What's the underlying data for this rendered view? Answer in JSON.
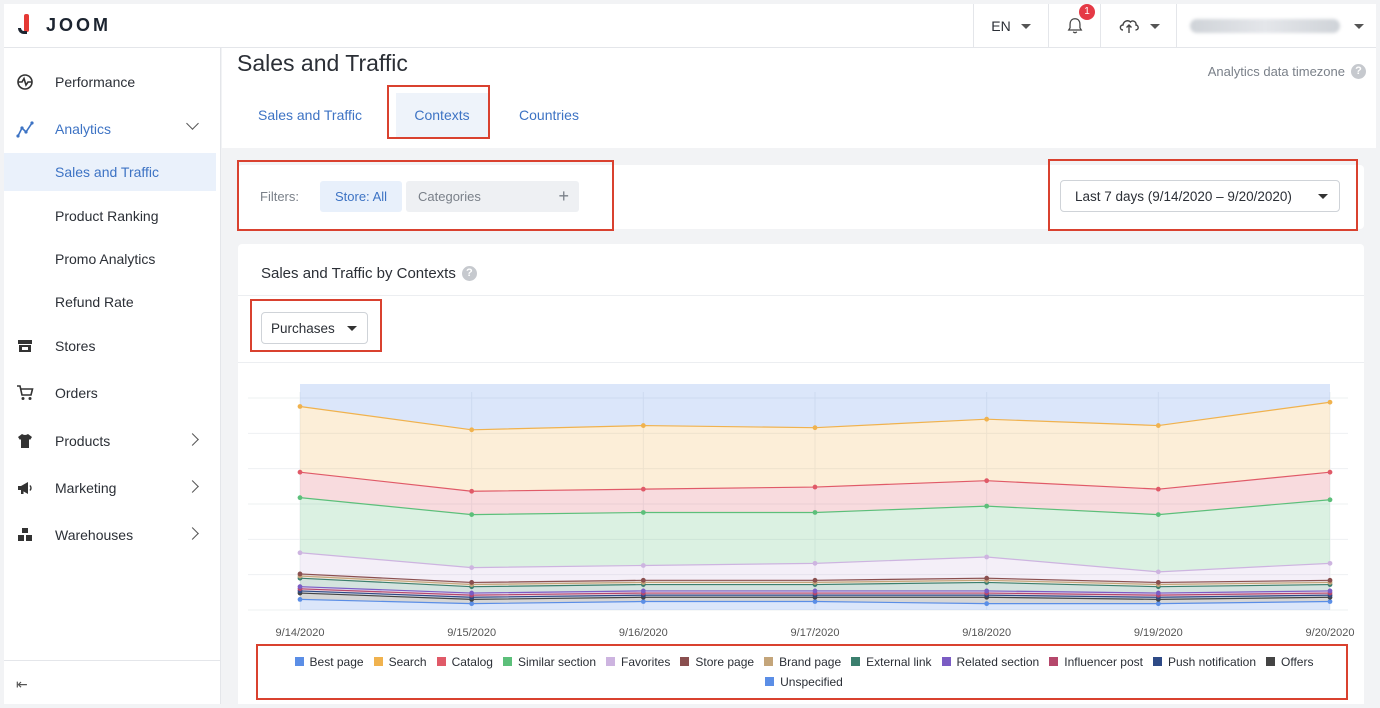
{
  "brand": {
    "name": "JOOM"
  },
  "topbar": {
    "language": "EN",
    "notifications_count": "1"
  },
  "sidebar": {
    "items": [
      {
        "label": "Performance",
        "icon": "performance-icon"
      },
      {
        "label": "Analytics",
        "icon": "analytics-icon"
      },
      {
        "label": "Stores",
        "icon": "store-icon"
      },
      {
        "label": "Orders",
        "icon": "cart-icon"
      },
      {
        "label": "Products",
        "icon": "shirt-icon"
      },
      {
        "label": "Marketing",
        "icon": "megaphone-icon"
      },
      {
        "label": "Warehouses",
        "icon": "warehouse-icon"
      }
    ],
    "analytics_sub": [
      "Sales and Traffic",
      "Product Ranking",
      "Promo Analytics",
      "Refund Rate"
    ],
    "collapse_glyph": "⇤"
  },
  "header": {
    "title": "Sales and Traffic",
    "timezone_label": "Analytics data timezone",
    "tabs": [
      "Sales and Traffic",
      "Contexts",
      "Countries"
    ],
    "active_tab": "Contexts"
  },
  "filters": {
    "label": "Filters:",
    "store_chip": "Store: All",
    "categories_chip": "Categories",
    "date_range": "Last 7 days (9/14/2020 – 9/20/2020)"
  },
  "chart_card": {
    "title": "Sales and Traffic by Contexts",
    "metric": "Purchases"
  },
  "colors": {
    "accent": "#3d73c4",
    "highlight_box": "#d9412f"
  },
  "chart_data": {
    "type": "area",
    "stacked": true,
    "x": [
      "9/14/2020",
      "9/15/2020",
      "9/16/2020",
      "9/17/2020",
      "9/18/2020",
      "9/19/2020",
      "9/20/2020"
    ],
    "ylim": [
      0,
      100
    ],
    "grid": true,
    "legend_position": "bottom",
    "series": [
      {
        "name": "Unspecified",
        "color": "#5b8ee6",
        "values": [
          5,
          3,
          4,
          4,
          3,
          3,
          4
        ]
      },
      {
        "name": "Offers",
        "color": "#444444",
        "values": [
          3,
          2,
          2,
          2,
          3,
          2,
          2
        ]
      },
      {
        "name": "Push notification",
        "color": "#2e4a86",
        "values": [
          1,
          1,
          1,
          1,
          1,
          1,
          1
        ]
      },
      {
        "name": "Influencer post",
        "color": "#b5476b",
        "values": [
          1,
          1,
          1,
          1,
          1,
          1,
          1
        ]
      },
      {
        "name": "Related section",
        "color": "#7b5cc4",
        "values": [
          1,
          1,
          1,
          1,
          1,
          1,
          1
        ]
      },
      {
        "name": "External link",
        "color": "#3b7f6e",
        "values": [
          4,
          3,
          3,
          3,
          4,
          3,
          3
        ]
      },
      {
        "name": "Brand page",
        "color": "#c4a57a",
        "values": [
          1,
          1,
          1,
          1,
          1,
          1,
          1
        ]
      },
      {
        "name": "Store page",
        "color": "#8a4f4f",
        "values": [
          1,
          1,
          1,
          1,
          1,
          1,
          1
        ]
      },
      {
        "name": "Favorites",
        "color": "#cdb4e0",
        "values": [
          10,
          7,
          7,
          8,
          10,
          5,
          8
        ]
      },
      {
        "name": "Similar section",
        "color": "#5cbf7a",
        "values": [
          26,
          25,
          25,
          24,
          24,
          27,
          30
        ]
      },
      {
        "name": "Catalog",
        "color": "#e05a68",
        "values": [
          12,
          11,
          11,
          12,
          12,
          12,
          13
        ]
      },
      {
        "name": "Search",
        "color": "#f0b24e",
        "values": [
          31,
          29,
          30,
          28,
          29,
          30,
          33
        ]
      },
      {
        "name": "Best page",
        "color": "#5b8ee6",
        "values": [
          31,
          30,
          30,
          30,
          29,
          27,
          32
        ]
      }
    ],
    "legend_order": [
      "Best page",
      "Search",
      "Catalog",
      "Similar section",
      "Favorites",
      "Store page",
      "Brand page",
      "External link",
      "Related section",
      "Influencer post",
      "Push notification",
      "Offers",
      "Unspecified"
    ]
  }
}
